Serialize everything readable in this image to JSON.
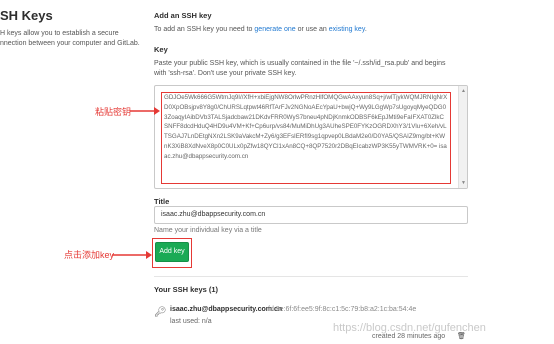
{
  "left": {
    "title": "SH Keys",
    "description_line1": "H keys allow you to establish a secure",
    "description_line2": "nnection between your computer and GitLab."
  },
  "form": {
    "section_title": "Add an SSH key",
    "intro_prefix": "To add an SSH key you need to ",
    "intro_link1": "generate one",
    "intro_mid": " or use an ",
    "intro_link2": "existing key",
    "intro_suffix": ".",
    "key_label": "Key",
    "key_help": "Paste your public SSH key, which is usually contained in the file '~/.ssh/id_rsa.pub' and begins with 'ssh-rsa'. Don't use your private SSH key.",
    "key_value": "GDJOe5Wk666G5WtmJq9I//XfH+xbiEjgNW8OrlwPRnzHlfOMQGwAAxyun8Sq+j/wlTjykWQMJRNIgNrXD0XpOBsjpv8Y8g0/ChURSLqtpwt46RfTArFJv2NGNoAEcYpaU+bwjQ+Wy9LGgWp7sUgoyqMyeQDG03ZoaqyIAibDVb3TALSjadcbaw21DKdvFRR0WyS7bneu4pNDjKnmkODBSF6kEpJMti9eFaIFXAT0ZlkCSNFF8dcdHduQ4HD9u4VM+Kf+Cp6urp/vs84/MuMiDhUg3AUheSPE0FYKzOGRDXhY3/1Vlu+6Xeh/vLTSGAJ7LnDEtgNXn2LSK9aVakcM+Zy6/g3EFsIERfI9sg1qpvep0LBdaM2e0/D0YA5/QSAIZ9mg/bt+KWnK3XiB8XdNveX8p0C0ULx0pZfw18QYCl1xAn8CQ+8QP7520r2DBqEIcabzWP3K55yTWMVRK+0= isaac.zhu@dbappsecurity.com.cn",
    "title_label": "Title",
    "title_value": "isaac.zhu@dbappsecurity.com.cn",
    "title_help": "Name your individual key via a title",
    "add_button": "Add key"
  },
  "annotations": {
    "paste_key": "粘贴密钥",
    "click_add": "点击添加key"
  },
  "keys": {
    "heading": "Your SSH keys (1)",
    "items": [
      {
        "name": "isaac.zhu@dbappsecurity.com.cn",
        "fingerprint": "fd:9e:6f:6f:ee5:9f:8c:c1:5c:79:b8:a2:1c:ba:54:4e",
        "last_used": "last used: n/a",
        "created": "created 28 minutes ago"
      }
    ]
  },
  "watermark": "https://blog.csdn.net/gufenchen",
  "colors": {
    "link": "#1f78d1",
    "button": "#1aaa55",
    "annotation": "#e53935"
  },
  "icons": {
    "key": "key-icon",
    "trash": "trash-icon",
    "arrow": "arrow-right-icon"
  }
}
